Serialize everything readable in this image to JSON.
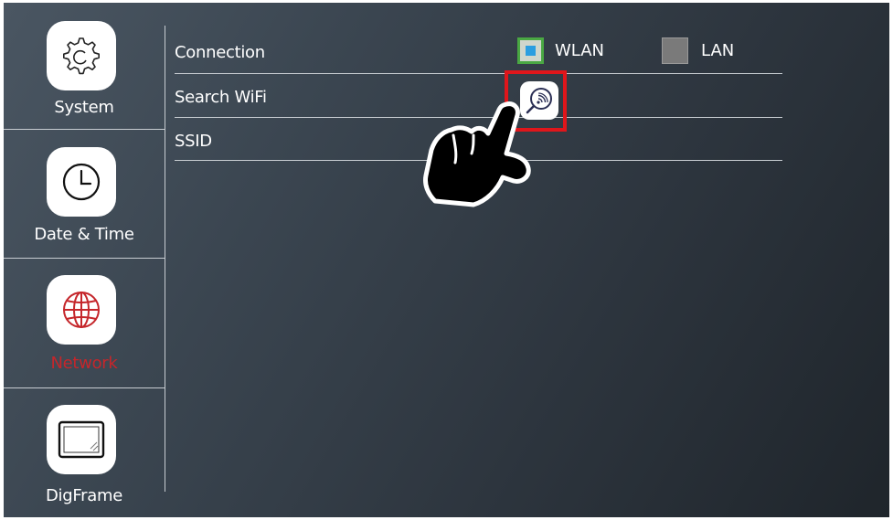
{
  "sidebar": {
    "items": [
      {
        "label": "System",
        "icon": "gear-icon",
        "active": false
      },
      {
        "label": "Date & Time",
        "icon": "clock-icon",
        "active": false
      },
      {
        "label": "Network",
        "icon": "globe-icon",
        "active": true
      },
      {
        "label": "DigFrame",
        "icon": "photo-frame-icon",
        "active": false
      }
    ]
  },
  "settings": {
    "connection": {
      "label": "Connection",
      "options": [
        {
          "label": "WLAN",
          "selected": true
        },
        {
          "label": "LAN",
          "selected": false
        }
      ]
    },
    "search_wifi": {
      "label": "Search WiFi",
      "icon": "wifi-search-icon"
    },
    "ssid": {
      "label": "SSID",
      "value": ""
    }
  },
  "overlay": {
    "icon": "pointing-hand-icon"
  },
  "colors": {
    "active": "#c5262b",
    "highlight": "#e0161b",
    "selected_border": "#4aa843",
    "selected_fill": "#2b9ee0"
  }
}
